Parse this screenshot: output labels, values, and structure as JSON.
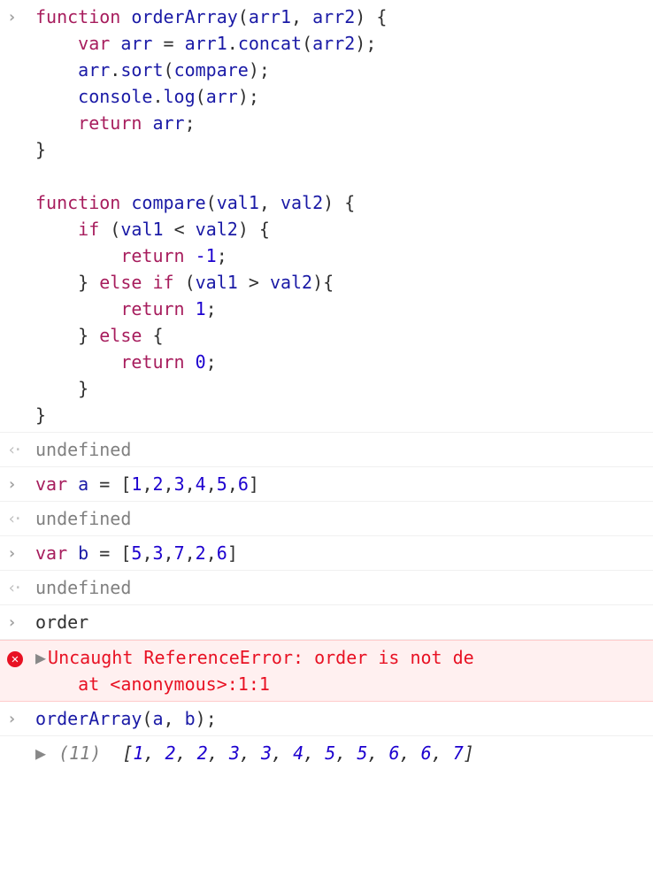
{
  "entries": [
    {
      "type": "input-code",
      "tokens": [
        [
          [
            "kw",
            "function"
          ],
          [
            "op",
            " "
          ],
          [
            "fn",
            "orderArray"
          ],
          [
            "op",
            "("
          ],
          [
            "id",
            "arr1"
          ],
          [
            "op",
            ", "
          ],
          [
            "id",
            "arr2"
          ],
          [
            "op",
            ") {"
          ]
        ],
        [
          [
            "op",
            "    "
          ],
          [
            "kw",
            "var"
          ],
          [
            "op",
            " "
          ],
          [
            "id",
            "arr"
          ],
          [
            "op",
            " = "
          ],
          [
            "id",
            "arr1"
          ],
          [
            "op",
            "."
          ],
          [
            "fn",
            "concat"
          ],
          [
            "op",
            "("
          ],
          [
            "id",
            "arr2"
          ],
          [
            "op",
            ");"
          ]
        ],
        [
          [
            "op",
            "    "
          ],
          [
            "id",
            "arr"
          ],
          [
            "op",
            "."
          ],
          [
            "fn",
            "sort"
          ],
          [
            "op",
            "("
          ],
          [
            "id",
            "compare"
          ],
          [
            "op",
            ");"
          ]
        ],
        [
          [
            "op",
            "    "
          ],
          [
            "id",
            "console"
          ],
          [
            "op",
            "."
          ],
          [
            "fn",
            "log"
          ],
          [
            "op",
            "("
          ],
          [
            "id",
            "arr"
          ],
          [
            "op",
            ");"
          ]
        ],
        [
          [
            "op",
            "    "
          ],
          [
            "kw",
            "return"
          ],
          [
            "op",
            " "
          ],
          [
            "id",
            "arr"
          ],
          [
            "op",
            ";"
          ]
        ],
        [
          [
            "op",
            "}"
          ]
        ],
        [
          [
            "op",
            ""
          ]
        ],
        [
          [
            "kw",
            "function"
          ],
          [
            "op",
            " "
          ],
          [
            "fn",
            "compare"
          ],
          [
            "op",
            "("
          ],
          [
            "id",
            "val1"
          ],
          [
            "op",
            ", "
          ],
          [
            "id",
            "val2"
          ],
          [
            "op",
            ") {"
          ]
        ],
        [
          [
            "op",
            "    "
          ],
          [
            "kw",
            "if"
          ],
          [
            "op",
            " ("
          ],
          [
            "id",
            "val1"
          ],
          [
            "op",
            " < "
          ],
          [
            "id",
            "val2"
          ],
          [
            "op",
            ") {"
          ]
        ],
        [
          [
            "op",
            "        "
          ],
          [
            "kw",
            "return"
          ],
          [
            "op",
            " "
          ],
          [
            "num",
            "-1"
          ],
          [
            "op",
            ";"
          ]
        ],
        [
          [
            "op",
            "    } "
          ],
          [
            "kw",
            "else if"
          ],
          [
            "op",
            " ("
          ],
          [
            "id",
            "val1"
          ],
          [
            "op",
            " > "
          ],
          [
            "id",
            "val2"
          ],
          [
            "op",
            "){"
          ]
        ],
        [
          [
            "op",
            "        "
          ],
          [
            "kw",
            "return"
          ],
          [
            "op",
            " "
          ],
          [
            "num",
            "1"
          ],
          [
            "op",
            ";"
          ]
        ],
        [
          [
            "op",
            "    } "
          ],
          [
            "kw",
            "else"
          ],
          [
            "op",
            " {"
          ]
        ],
        [
          [
            "op",
            "        "
          ],
          [
            "kw",
            "return"
          ],
          [
            "op",
            " "
          ],
          [
            "num",
            "0"
          ],
          [
            "op",
            ";"
          ]
        ],
        [
          [
            "op",
            "    }"
          ]
        ],
        [
          [
            "op",
            "}"
          ]
        ]
      ]
    },
    {
      "type": "output-undefined",
      "text": "undefined"
    },
    {
      "type": "input-code",
      "tokens": [
        [
          [
            "kw",
            "var"
          ],
          [
            "op",
            " "
          ],
          [
            "id",
            "a"
          ],
          [
            "op",
            " = ["
          ],
          [
            "num",
            "1"
          ],
          [
            "op",
            ","
          ],
          [
            "num",
            "2"
          ],
          [
            "op",
            ","
          ],
          [
            "num",
            "3"
          ],
          [
            "op",
            ","
          ],
          [
            "num",
            "4"
          ],
          [
            "op",
            ","
          ],
          [
            "num",
            "5"
          ],
          [
            "op",
            ","
          ],
          [
            "num",
            "6"
          ],
          [
            "op",
            "]"
          ]
        ]
      ]
    },
    {
      "type": "output-undefined",
      "text": "undefined"
    },
    {
      "type": "input-code",
      "tokens": [
        [
          [
            "kw",
            "var"
          ],
          [
            "op",
            " "
          ],
          [
            "id",
            "b"
          ],
          [
            "op",
            " = ["
          ],
          [
            "num",
            "5"
          ],
          [
            "op",
            ","
          ],
          [
            "num",
            "3"
          ],
          [
            "op",
            ","
          ],
          [
            "num",
            "7"
          ],
          [
            "op",
            ","
          ],
          [
            "num",
            "2"
          ],
          [
            "op",
            ","
          ],
          [
            "num",
            "6"
          ],
          [
            "op",
            "]"
          ]
        ]
      ]
    },
    {
      "type": "output-undefined",
      "text": "undefined"
    },
    {
      "type": "input-code",
      "tokens": [
        [
          [
            "op",
            "order"
          ]
        ]
      ]
    },
    {
      "type": "error",
      "message": "Uncaught ReferenceError: order is not de",
      "stack": "    at <anonymous>:1:1"
    },
    {
      "type": "input-code",
      "tokens": [
        [
          [
            "fn",
            "orderArray"
          ],
          [
            "op",
            "("
          ],
          [
            "id",
            "a"
          ],
          [
            "op",
            ", "
          ],
          [
            "id",
            "b"
          ],
          [
            "op",
            ");"
          ]
        ]
      ]
    },
    {
      "type": "output-array",
      "count": 11,
      "values": [
        1,
        2,
        2,
        3,
        3,
        4,
        5,
        5,
        6,
        6,
        7
      ]
    }
  ]
}
